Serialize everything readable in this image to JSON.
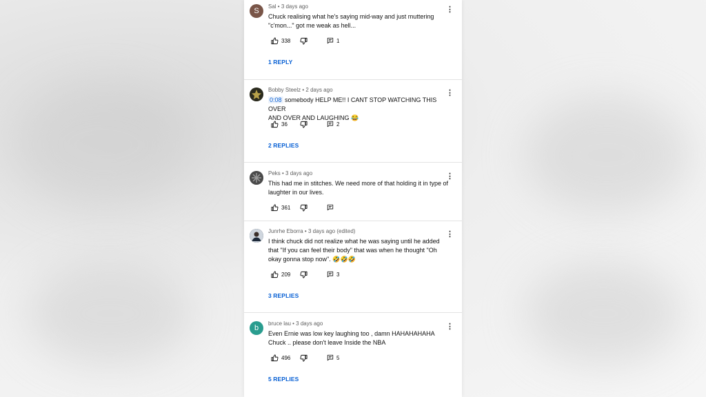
{
  "comments": [
    {
      "author": "Sal",
      "time": "3 days ago",
      "edited": "",
      "avatar_letter": "S",
      "avatar_color": "#795548",
      "text_lines": [
        "Chuck realising what he's saying mid-way and just muttering",
        "\"c'mon...\" got me weak as hell..."
      ],
      "timestamp": "",
      "likes": "338",
      "reply_count": "1",
      "replies_label": "1 REPLY"
    },
    {
      "author": "Bobby Steelz",
      "time": "2 days ago",
      "edited": "",
      "avatar_letter": "",
      "avatar_color": "#2b2b1e",
      "text_lines": [
        "somebody HELP ME!! I CANT STOP WATCHING THIS OVER",
        "AND OVER AND LAUGHING 😂"
      ],
      "timestamp": "0:08",
      "likes": "36",
      "reply_count": "2",
      "replies_label": "2 REPLIES"
    },
    {
      "author": "Peks",
      "time": "3 days ago",
      "edited": "",
      "avatar_letter": "",
      "avatar_color": "#3a3a3a",
      "text_lines": [
        "This had me in stitches. We need more of that holding it in type of",
        "laughter in our lives."
      ],
      "timestamp": "",
      "likes": "361",
      "reply_count": "",
      "replies_label": ""
    },
    {
      "author": "Junrhe Eborra",
      "time": "3 days ago",
      "edited": "(edited)",
      "avatar_letter": "",
      "avatar_color": "#2e3a4a",
      "text_lines": [
        "I think chuck did not realize what he was saying until he added",
        "that \"If you can feel their body\" that was when he thought \"Oh",
        "okay gonna stop now\". 🤣🤣🤣"
      ],
      "timestamp": "",
      "likes": "209",
      "reply_count": "3",
      "replies_label": "3 REPLIES"
    },
    {
      "author": "bruce lau",
      "time": "3 days ago",
      "edited": "",
      "avatar_letter": "b",
      "avatar_color": "#2a9d8f",
      "text_lines": [
        "Even Ernie was low key laughing too , damn HAHAHAHAHA",
        "Chuck .. please don't leave Inside the NBA"
      ],
      "timestamp": "",
      "likes": "496",
      "reply_count": "5",
      "replies_label": "5 REPLIES"
    }
  ],
  "colors": {
    "link": "#065fd4",
    "meta": "#606060",
    "text": "#0f0f0f",
    "divider": "#e3e3e3"
  },
  "icons": {
    "like": "thumbs-up-icon",
    "dislike": "thumbs-down-icon",
    "reply": "reply-icon",
    "more": "vertical-dots-icon"
  }
}
